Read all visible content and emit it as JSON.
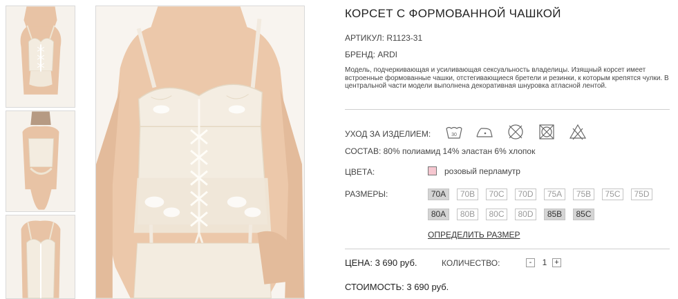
{
  "product": {
    "title": "КОРСЕТ С ФОРМОВАННОЙ ЧАШКОЙ",
    "article": "АРТИКУЛ: R1123-31",
    "brand": "БРЕНД: ARDI",
    "description": "Модель, подчеркивающая и усиливающая сексуальность владелицы. Изящный корсет имеет встроенные формованные чашки, отстегивающиеся бретели и резинки, к которым крепятся чулки. В центральной части модели выполнена декоративная шнуровка атласной лентой."
  },
  "care": {
    "label": "УХОД ЗА ИЗДЕЛИЕМ:",
    "icons": [
      "wash-30-icon",
      "iron-low-icon",
      "no-dry-clean-icon",
      "no-tumble-dry-icon",
      "no-bleach-icon"
    ]
  },
  "composition": "СОСТАВ: 80% полиамид 14% эластан 6% хлопок",
  "colors": {
    "label": "ЦВЕТА:",
    "selected": {
      "name": "розовый перламутр",
      "hex": "#f6c7d0"
    }
  },
  "sizes": {
    "label": "РАЗМЕРЫ:",
    "items": [
      {
        "label": "70A",
        "available": true
      },
      {
        "label": "70B",
        "available": false
      },
      {
        "label": "70C",
        "available": false
      },
      {
        "label": "70D",
        "available": false
      },
      {
        "label": "75A",
        "available": false
      },
      {
        "label": "75B",
        "available": false
      },
      {
        "label": "75C",
        "available": false
      },
      {
        "label": "75D",
        "available": false
      },
      {
        "label": "80A",
        "available": true
      },
      {
        "label": "80B",
        "available": false
      },
      {
        "label": "80C",
        "available": false
      },
      {
        "label": "80D",
        "available": false
      },
      {
        "label": "85B",
        "available": true
      },
      {
        "label": "85C",
        "available": true
      }
    ],
    "size_link": "ОПРЕДЕЛИТЬ РАЗМЕР"
  },
  "price": "ЦЕНА: 3 690 руб.",
  "quantity": {
    "label": "КОЛИЧЕСТВО:",
    "value": "1",
    "minus": "-",
    "plus": "+"
  },
  "total": "СТОИМОСТЬ: 3 690 руб.",
  "colors_palette": {
    "product_cream": "#f3ece0",
    "skin": "#e9c4a6",
    "available_size_bg": "#d4d4d4"
  }
}
